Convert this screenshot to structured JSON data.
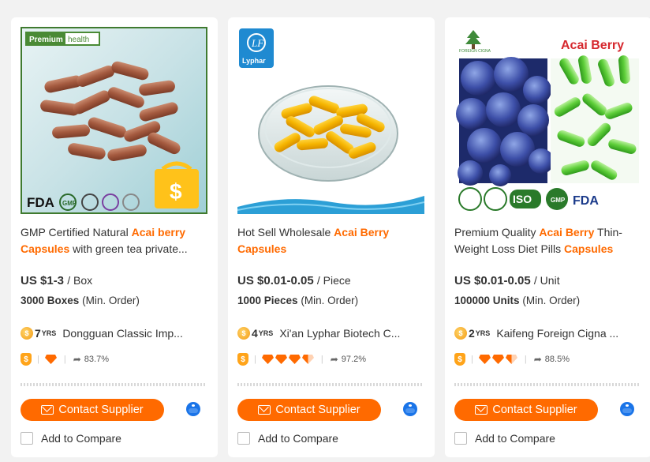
{
  "products": [
    {
      "image_badge": "Premium health",
      "image_certs": [
        "FDA",
        "GMP",
        "ISO",
        "Halal"
      ],
      "title_parts": [
        {
          "text": "GMP Certified Natural ",
          "hl": false
        },
        {
          "text": "Acai berry Capsules",
          "hl": true
        },
        {
          "text": " with green tea private...",
          "hl": false
        }
      ],
      "price": "US $1-3",
      "price_unit": "/ Box",
      "moq_qty": "3000 Boxes",
      "moq_label": "(Min. Order)",
      "years": "7",
      "years_suffix": "YRS",
      "supplier": "Dongguan Classic Imp...",
      "diamonds": 1,
      "response_rate": "83.7%",
      "contact_label": "Contact Supplier",
      "compare_label": "Add to Compare"
    },
    {
      "image_logo": "Lyphar",
      "title_parts": [
        {
          "text": "Hot Sell Wholesale ",
          "hl": false
        },
        {
          "text": "Acai Berry Capsules",
          "hl": true
        }
      ],
      "price": "US $0.01-0.05",
      "price_unit": "/ Piece",
      "moq_qty": "1000 Pieces",
      "moq_label": "(Min. Order)",
      "years": "4",
      "years_suffix": "YRS",
      "supplier": "Xi'an Lyphar Biotech C...",
      "diamonds": 3.5,
      "response_rate": "97.2%",
      "contact_label": "Contact Supplier",
      "compare_label": "Add to Compare"
    },
    {
      "image_title": "Acai Berry",
      "image_brand": "FOREIGN CIGNA",
      "image_certs": [
        "ISO",
        "GMP",
        "FDA"
      ],
      "title_parts": [
        {
          "text": "Premium Quality ",
          "hl": false
        },
        {
          "text": "Acai Berry",
          "hl": true
        },
        {
          "text": " Thin-Weight Loss Diet Pills ",
          "hl": false
        },
        {
          "text": "Capsules",
          "hl": true
        }
      ],
      "price": "US $0.01-0.05",
      "price_unit": "/ Unit",
      "moq_qty": "100000 Units",
      "moq_label": "(Min. Order)",
      "years": "2",
      "years_suffix": "YRS",
      "supplier": "Kaifeng Foreign Cigna ...",
      "diamonds": 2.5,
      "response_rate": "88.5%",
      "contact_label": "Contact Supplier",
      "compare_label": "Add to Compare"
    }
  ],
  "colors": {
    "accent": "#ff6a00",
    "chat": "#1a74e8",
    "background": "#f2f2f2"
  }
}
